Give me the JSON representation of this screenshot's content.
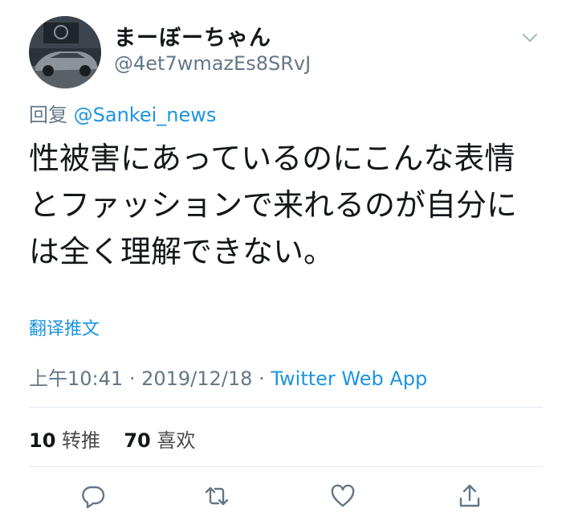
{
  "user": {
    "display_name": "まーぼーちゃん",
    "handle": "@4et7wmazEs8SRvJ",
    "avatar": "profile-photo-car"
  },
  "reply": {
    "prefix": "回复",
    "mention": "@Sankei_news"
  },
  "tweet": {
    "lines": [
      "性被害にあっているのにこんな表情",
      "とファッションで来れるのが自分に",
      "は全く理解できない。"
    ]
  },
  "translate_label": "翻译推文",
  "meta": {
    "time": "上午10:41",
    "separator": "·",
    "date": "2019/12/18",
    "source": "Twitter Web App"
  },
  "stats": {
    "retweets": "10",
    "retweets_label": "转推",
    "likes": "70",
    "likes_label": "喜欢"
  },
  "actions": [
    "reply-icon",
    "retweet-icon",
    "like-icon",
    "share-icon"
  ],
  "colors": {
    "link": "#1b95e0",
    "secondary": "#657786",
    "text": "#14171a",
    "divider": "#e1e8ed"
  }
}
